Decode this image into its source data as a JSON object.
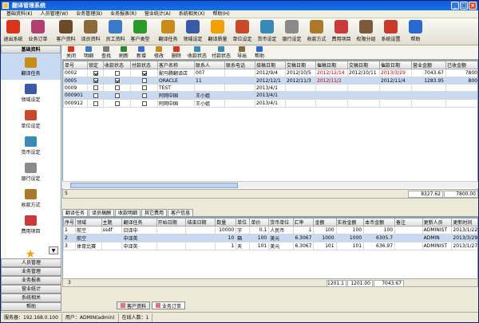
{
  "window": {
    "title": "翻译管理系统"
  },
  "menu": [
    "基础资料(K)",
    "人员管理(W)",
    "业务管理(B)",
    "业务报表(R)",
    "营业统计(A)",
    "系统相关(X)",
    "帮助(H)"
  ],
  "toolbar": [
    {
      "label": "退出系统",
      "icon": "exit-icon",
      "color": "#d9341c"
    },
    {
      "label": "业务订单",
      "icon": "orders-icon",
      "color": "#b04070"
    },
    {
      "label": "客户资料",
      "icon": "customer-icon",
      "color": "#6a4a2a"
    },
    {
      "label": "译员资料",
      "icon": "translator-icon",
      "color": "#8a6a3a"
    },
    {
      "label": "员工资料",
      "icon": "staff-icon",
      "color": "#3a7ac8"
    },
    {
      "label": "客户类型",
      "icon": "chart-icon",
      "color": "#2a9a2a"
    },
    {
      "label": "翻译任务",
      "icon": "task-icon",
      "color": "#c88a1a"
    },
    {
      "label": "领域设定",
      "icon": "tex-icon",
      "color": "#3a5aa8"
    },
    {
      "label": "翻译质量",
      "icon": "star-icon",
      "color": "#f2a000"
    },
    {
      "label": "单位设定",
      "icon": "unit-icon",
      "color": "#c84a2a"
    },
    {
      "label": "货币设定",
      "icon": "currency-icon",
      "color": "#3a8ab8"
    },
    {
      "label": "银行设定",
      "icon": "bank-icon",
      "color": "#8a8a8a"
    },
    {
      "label": "收款方式",
      "icon": "payment-icon",
      "color": "#aa7a2a"
    },
    {
      "label": "费用项目",
      "icon": "expense-icon",
      "color": "#c83a3a"
    },
    {
      "label": "权限分组",
      "icon": "users-icon",
      "color": "#7a5a3a"
    },
    {
      "label": "系统设置",
      "icon": "tools-icon",
      "color": "#c83a2a"
    },
    {
      "label": "帮助",
      "icon": "help-icon",
      "color": "#2a6ad0"
    }
  ],
  "sidebar": {
    "header": "基础资料",
    "items": [
      {
        "label": "翻译任务",
        "icon": "task-icon",
        "color": "#c88a1a"
      },
      {
        "label": "领域设定",
        "icon": "tex-icon",
        "color": "#3a5aa8"
      },
      {
        "label": "单位设定",
        "icon": "unit-icon",
        "color": "#c84a2a"
      },
      {
        "label": "货币设定",
        "icon": "currency-icon",
        "color": "#3a8ab8"
      },
      {
        "label": "银行设定",
        "icon": "bank-icon",
        "color": "#8a8a8a"
      },
      {
        "label": "收款方式",
        "icon": "payment-icon",
        "color": "#aa7a2a"
      },
      {
        "label": "费用项目",
        "icon": "expense-icon",
        "color": "#c83a3a"
      }
    ],
    "more": "▼",
    "buttons": [
      "人员管理",
      "业务管理",
      "业务报表",
      "营业统计",
      "系统相关",
      "帮助"
    ]
  },
  "subtoolbar": [
    {
      "label": "关闭",
      "color": "#d9341c"
    },
    {
      "label": "明细",
      "color": "#3a7ac8"
    },
    {
      "label": "查找",
      "color": "#7a7a7a"
    },
    {
      "label": "刷新",
      "color": "#2a8a2a"
    },
    {
      "label": "新增",
      "color": "#3a6ad0"
    },
    {
      "label": "修改",
      "color": "#c88a1a"
    },
    {
      "label": "删除",
      "color": "#d9341c"
    },
    {
      "label": "收款状态",
      "color": "#3a8ab8"
    },
    {
      "label": "付款状态",
      "color": "#3a8ab8"
    },
    {
      "label": "导出",
      "color": "#8a6a3a"
    },
    {
      "label": "帮助",
      "color": "#2a6ad0"
    }
  ],
  "orders": {
    "columns": [
      "单号",
      "锁定",
      "收款状态",
      "付款状态",
      "客户名称",
      "联系人",
      "联系电话",
      "接稿日期",
      "交稿日期",
      "催稿日期",
      "交稿日期",
      "催款日期",
      "营业金额",
      "已收金额"
    ],
    "rows": [
      {
        "cells": [
          "0002",
          "✓",
          "",
          "✓",
          "配马腾翻译店",
          "007",
          "",
          "2012/9/4",
          "2012/10/5",
          "2012/12/14",
          "2012/10/11",
          "2013/3/29",
          "7043.67",
          "7800"
        ],
        "sel": false
      },
      {
        "cells": [
          "0005",
          "✓",
          "✓",
          "",
          "ORACLE",
          "11",
          "",
          "2012/12/1",
          "2012/11/3",
          "2012/11/2",
          "",
          "2012/11/4",
          "1283.95",
          "800"
        ],
        "sel": true
      },
      {
        "cells": [
          "0009",
          "",
          "",
          "",
          "TEST",
          "",
          "",
          "2013/4/1",
          "",
          "",
          "",
          "",
          "",
          ""
        ],
        "sel": false
      },
      {
        "cells": [
          "000901",
          "",
          "",
          "",
          "阿网中国",
          "王小姐",
          "",
          "2013/4/1",
          "",
          "",
          "",
          "",
          "",
          ""
        ],
        "sel": true
      },
      {
        "cells": [
          "000912",
          "",
          "",
          "",
          "阿网中国",
          "王小姐",
          "",
          "2013/4/1",
          "",
          "",
          "",
          "",
          "",
          ""
        ],
        "sel": false
      }
    ],
    "footer_count": "5",
    "footer_total1": "8327.62",
    "footer_total2": "7800.00"
  },
  "detail_tabs": [
    "翻译任务",
    "译员稿酬",
    "收款明细",
    "其它费用",
    "客户信息"
  ],
  "tasks": {
    "columns": [
      "序号",
      "领域",
      "主题",
      "翻译任务",
      "开始日期",
      "结束日期",
      "数量",
      "单位",
      "单价",
      "货币单位",
      "汇率",
      "金额",
      "实收金额",
      "本币金额",
      "备注",
      "更新人员",
      "更新时间"
    ],
    "rows": [
      {
        "cells": [
          "1",
          "航空",
          "ssdf",
          "日译中",
          "",
          "",
          "10000",
          "字",
          "0.1",
          "人民币",
          "1",
          "100",
          "100",
          "100",
          "",
          "ADMINIST",
          "2013/1/22"
        ],
        "sel": false
      },
      {
        "cells": [
          "2",
          "航空",
          "",
          "中译英",
          "",
          "",
          "10",
          "箱",
          "100",
          "美元",
          "6.3067",
          "1000",
          "1000",
          "6305.7",
          "",
          "ADMIN",
          "2013/3/29"
        ],
        "sel": true
      },
      {
        "cells": [
          "3",
          "体育比赛",
          "",
          "中译英",
          "",
          "",
          "1",
          "天",
          "101",
          "美元",
          "6.3067",
          "101",
          "101",
          "636.97",
          "",
          "ADMINIST",
          "2013/1/27"
        ],
        "sel": false
      }
    ],
    "footer_count": "3",
    "footer_a": "1201.1",
    "footer_b": "1201.00",
    "footer_c": "7043.67"
  },
  "bottom_tabs": [
    {
      "label": "客户资料",
      "active": false
    },
    {
      "label": "业务订单",
      "active": true
    }
  ],
  "status": {
    "server": "服务器：192.168.0.100",
    "user": "用户：ADMIN(admin)",
    "online": "在线人数：1"
  }
}
